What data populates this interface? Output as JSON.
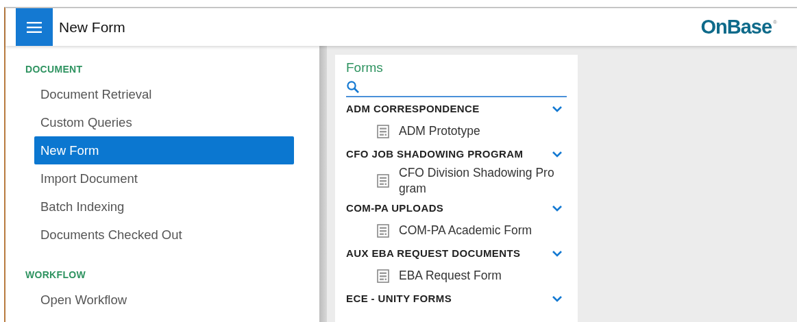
{
  "header": {
    "title": "New Form",
    "logo": "OnBase",
    "logo_mark": "®"
  },
  "sidebar": {
    "sections": [
      {
        "heading": "DOCUMENT",
        "items": [
          {
            "label": "Document Retrieval",
            "selected": false
          },
          {
            "label": "Custom Queries",
            "selected": false
          },
          {
            "label": "New Form",
            "selected": true
          },
          {
            "label": "Import Document",
            "selected": false
          },
          {
            "label": "Batch Indexing",
            "selected": false
          },
          {
            "label": "Documents Checked Out",
            "selected": false
          }
        ]
      },
      {
        "heading": "WORKFLOW",
        "items": [
          {
            "label": "Open Workflow",
            "selected": false
          }
        ]
      }
    ]
  },
  "forms": {
    "title": "Forms",
    "groups": [
      {
        "name": "ADM CORRESPONDENCE",
        "expanded": true,
        "items": [
          "ADM Prototype"
        ]
      },
      {
        "name": "CFO JOB SHADOWING PROGRAM",
        "expanded": true,
        "items": [
          "CFO Division Shadowing Program"
        ]
      },
      {
        "name": "COM-PA UPLOADS",
        "expanded": true,
        "items": [
          "COM-PA Academic Form"
        ]
      },
      {
        "name": "AUX EBA REQUEST DOCUMENTS",
        "expanded": true,
        "items": [
          "EBA Request Form"
        ]
      },
      {
        "name": "ECE - UNITY FORMS",
        "expanded": true
      }
    ]
  }
}
